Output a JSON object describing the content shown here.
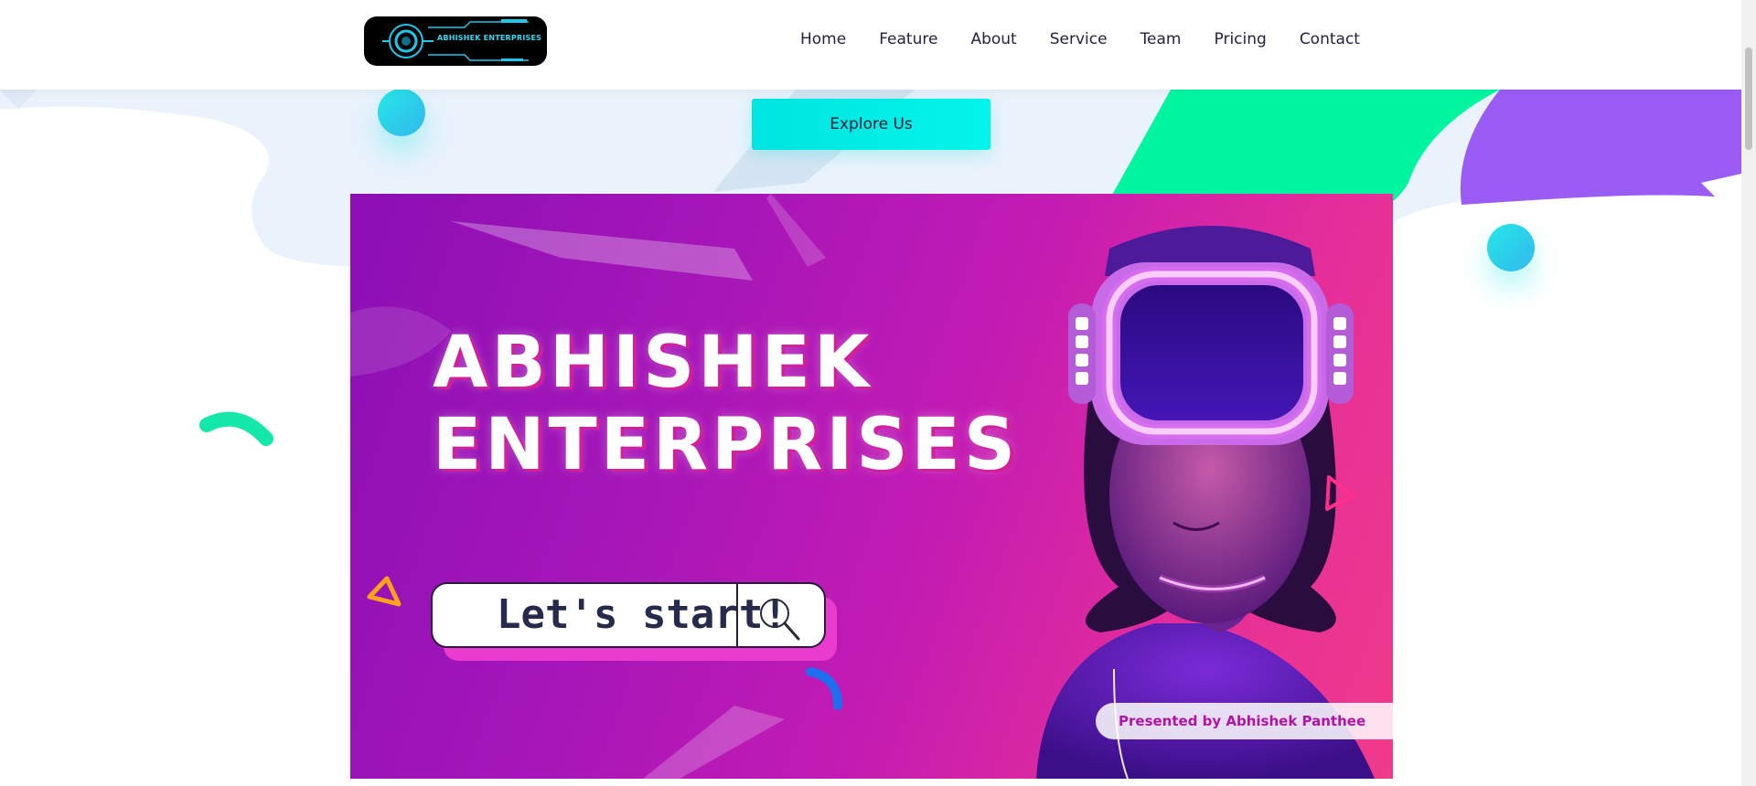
{
  "header": {
    "logo_text": "ABHISHEK ENTERPRISES",
    "nav": [
      "Home",
      "Feature",
      "About",
      "Service",
      "Team",
      "Pricing",
      "Contact"
    ]
  },
  "hero": {
    "explore_label": "Explore Us",
    "banner": {
      "title_line1": "ABHISHEK",
      "title_line2": "ENTERPRISES",
      "search_text": "Let's start!",
      "presented_by": "Presented by Abhishek Panthee"
    }
  },
  "colors": {
    "accent_cyan": "#00e5e1",
    "accent_green": "#00f5a0",
    "accent_purple": "#9b5cf6",
    "banner_magenta": "#c21bb4",
    "nav_text": "#1f2140"
  },
  "icons": [
    "search-icon",
    "logo-emblem-icon",
    "triangle-icon",
    "arc-icon",
    "vr-headset-icon"
  ]
}
